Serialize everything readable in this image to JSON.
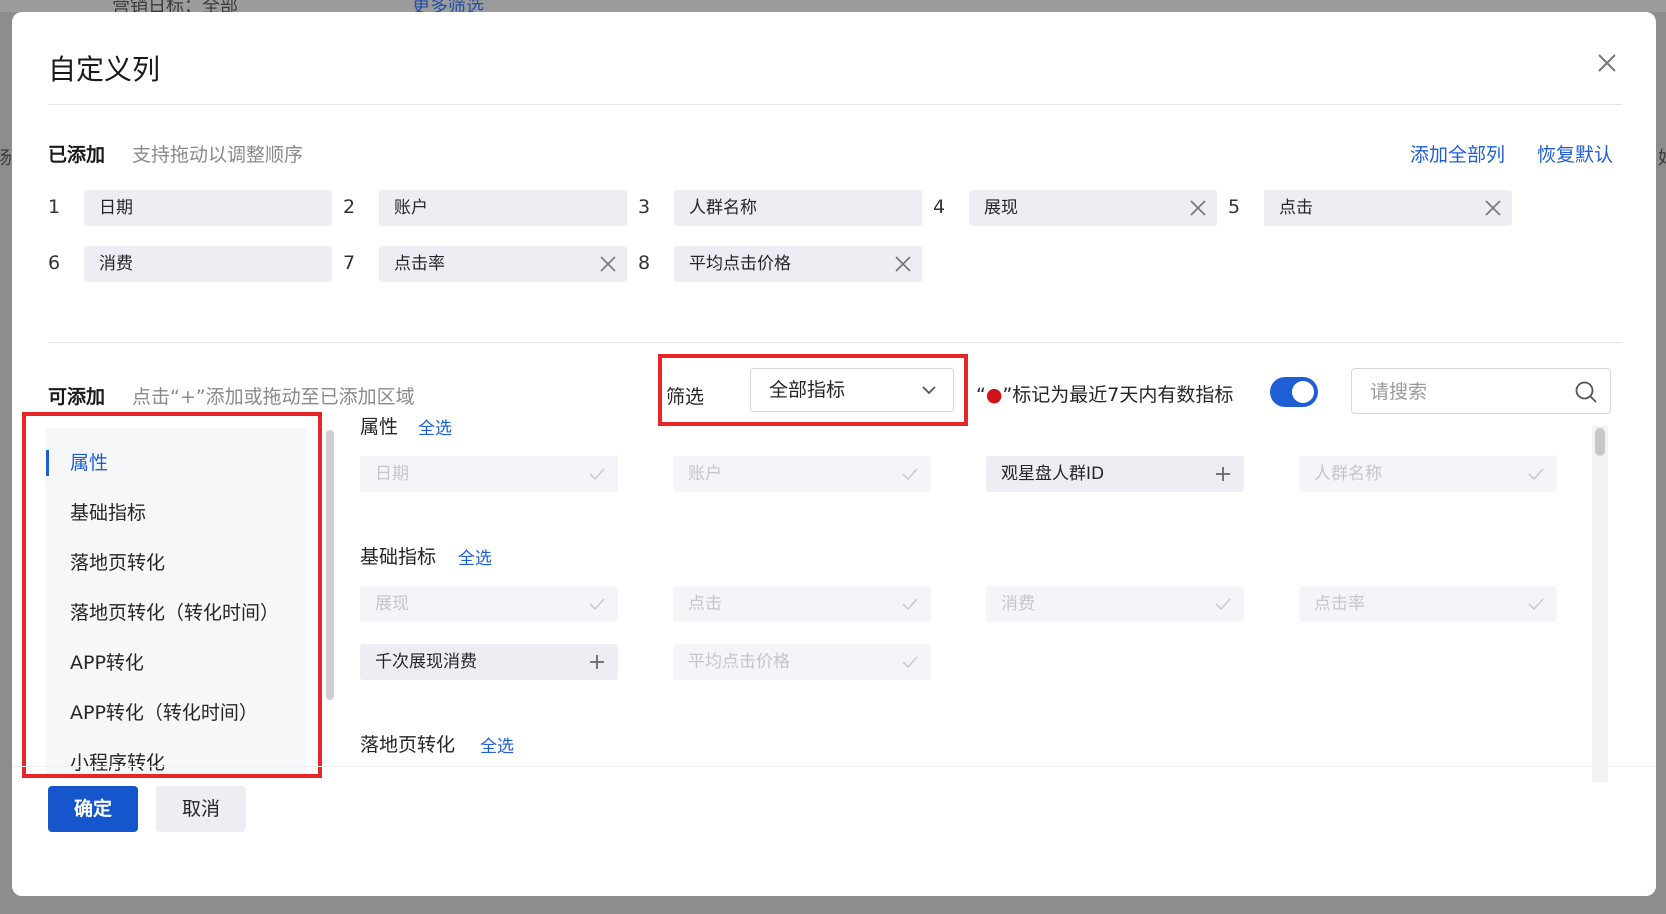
{
  "background": {
    "top_fragment": "营销日标：全部",
    "top_link_fragment": "更多筛选",
    "left_fragment": "场",
    "right_fragment": "好"
  },
  "modal": {
    "title": "自定义列",
    "added": {
      "label": "已添加",
      "hint": "支持拖动以调整顺序",
      "add_all": "添加全部列",
      "restore_default": "恢复默认",
      "columns": [
        {
          "index": "1",
          "name": "日期",
          "removable": false
        },
        {
          "index": "2",
          "name": "账户",
          "removable": false
        },
        {
          "index": "3",
          "name": "人群名称",
          "removable": false
        },
        {
          "index": "4",
          "name": "展现",
          "removable": true
        },
        {
          "index": "5",
          "name": "点击",
          "removable": true
        },
        {
          "index": "6",
          "name": "消费",
          "removable": false
        },
        {
          "index": "7",
          "name": "点击率",
          "removable": true
        },
        {
          "index": "8",
          "name": "平均点击价格",
          "removable": true
        }
      ]
    },
    "available": {
      "label": "可添加",
      "hint": "点击“+”添加或拖动至已添加区域",
      "filter_label": "筛选",
      "filter_value": "全部指标",
      "marker_quote_open": "“",
      "marker_dot": "●",
      "marker_text": "”标记为最近7天内有数指标",
      "toggle_on": true,
      "search_placeholder": "请搜索",
      "categories": [
        "属性",
        "基础指标",
        "落地页转化",
        "落地页转化（转化时间）",
        "APP转化",
        "APP转化（转化时间）",
        "小程序转化"
      ],
      "active_category": "属性",
      "select_all": "全选",
      "groups": [
        {
          "title": "属性",
          "items": [
            {
              "name": "日期",
              "added": true
            },
            {
              "name": "账户",
              "added": true
            },
            {
              "name": "观星盘人群ID",
              "added": false
            },
            {
              "name": "人群名称",
              "added": true
            }
          ]
        },
        {
          "title": "基础指标",
          "items": [
            {
              "name": "展现",
              "added": true
            },
            {
              "name": "点击",
              "added": true
            },
            {
              "name": "消费",
              "added": true
            },
            {
              "name": "点击率",
              "added": true
            },
            {
              "name": "千次展现消费",
              "added": false
            },
            {
              "name": "平均点击价格",
              "added": true
            }
          ]
        },
        {
          "title": "落地页转化",
          "items": []
        }
      ]
    },
    "footer": {
      "confirm": "确定",
      "cancel": "取消"
    }
  },
  "colors": {
    "accent": "#1f5fd6",
    "primary_button": "#1556cc",
    "highlight_box": "#e8262a",
    "marker_dot": "#d0121b"
  }
}
